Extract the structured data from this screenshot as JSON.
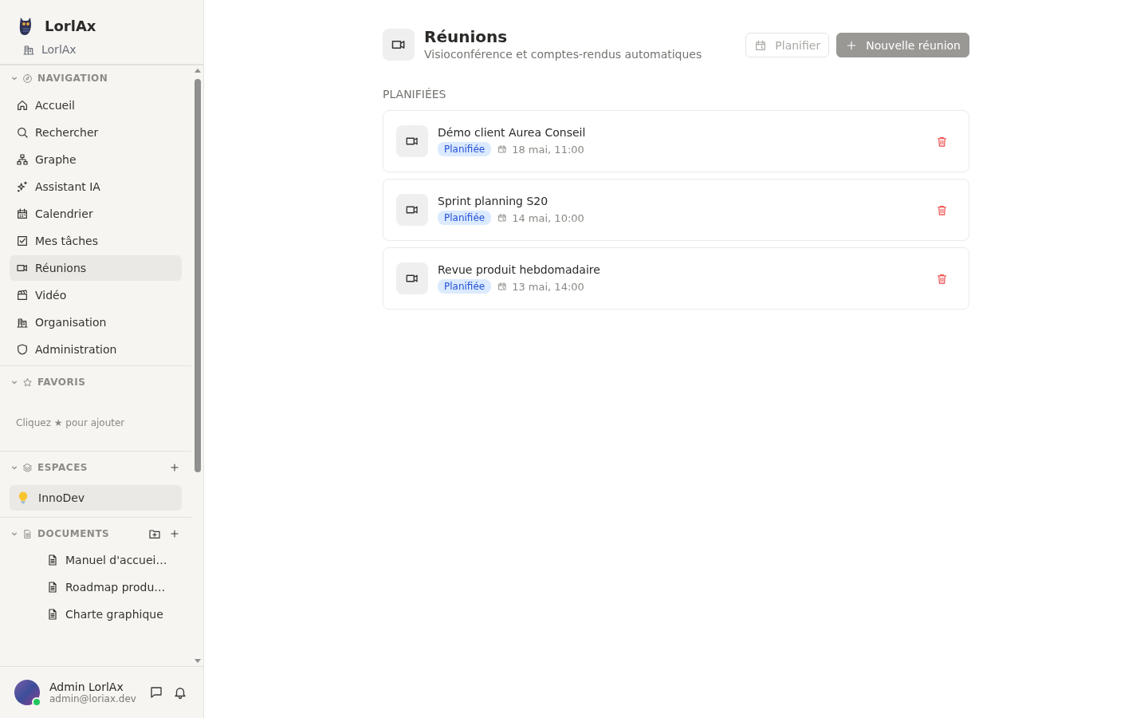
{
  "sidebar": {
    "brand": "LorlAx",
    "workspace": "LorlAx",
    "navigation": {
      "title": "NAVIGATION",
      "expanded": true,
      "items": [
        {
          "label": "Accueil",
          "selected": false
        },
        {
          "label": "Rechercher",
          "selected": false
        },
        {
          "label": "Graphe",
          "selected": false
        },
        {
          "label": "Assistant IA",
          "selected": false
        },
        {
          "label": "Calendrier",
          "selected": false
        },
        {
          "label": "Mes tâches",
          "selected": false
        },
        {
          "label": "Réunions",
          "selected": true
        },
        {
          "label": "Vidéo",
          "selected": false
        },
        {
          "label": "Organisation",
          "selected": false
        },
        {
          "label": "Administration",
          "selected": false
        }
      ]
    },
    "favorites": {
      "title": "FAVORIS",
      "expanded": true,
      "empty_hint": "Cliquez ★ pour ajouter"
    },
    "spaces": {
      "title": "ESPACES",
      "expanded": true,
      "items": [
        {
          "label": "InnoDev",
          "selected": true
        }
      ]
    },
    "documents": {
      "title": "DOCUMENTS",
      "expanded": true,
      "items": [
        {
          "label": "Manuel d'accuei…"
        },
        {
          "label": "Roadmap produ…"
        },
        {
          "label": "Charte graphique"
        }
      ]
    },
    "user": {
      "name": "Admin LorlAx",
      "email": "admin@loriax.dev",
      "online": true
    }
  },
  "page": {
    "title": "Réunions",
    "subtitle": "Visioconférence et comptes-rendus automatiques",
    "buttons": [
      {
        "label": "Planifier",
        "kind": "schedule",
        "disabled": true
      },
      {
        "label": "Nouvelle réunion",
        "kind": "new",
        "disabled": true
      }
    ],
    "section": "PLANIFIÉES",
    "meetings": [
      {
        "title": "Démo client Aurea Conseil",
        "status": "Planifiée",
        "when": "18 mai, 11:00"
      },
      {
        "title": "Sprint planning S20",
        "status": "Planifiée",
        "when": "14 mai, 10:00"
      },
      {
        "title": "Revue produit hebdomadaire",
        "status": "Planifiée",
        "when": "13 mai, 14:00"
      }
    ]
  }
}
